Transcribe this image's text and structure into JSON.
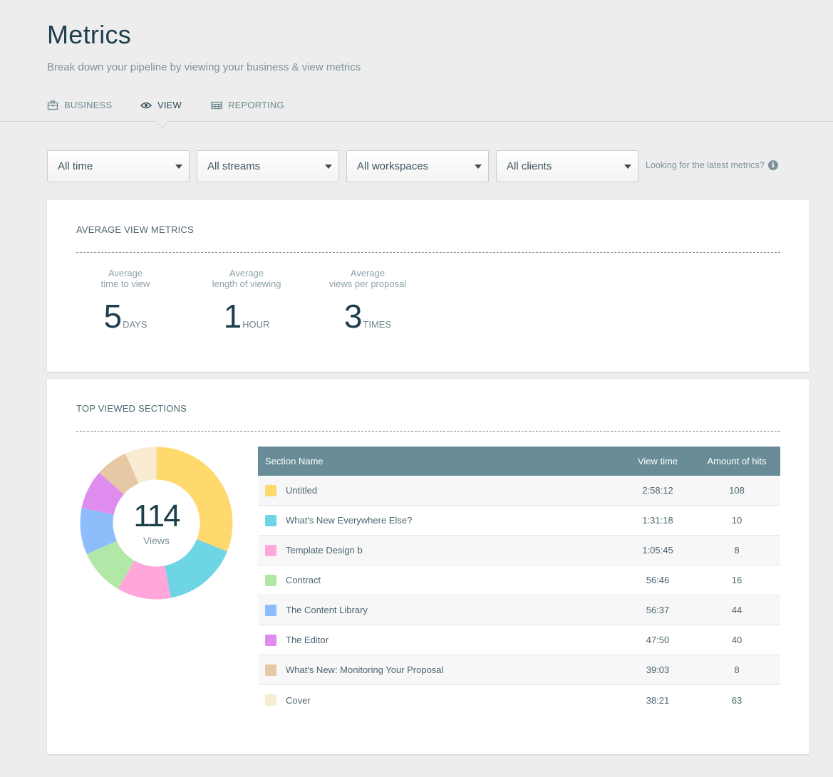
{
  "header": {
    "title": "Metrics",
    "subtitle": "Break down your pipeline by viewing your business & view metrics"
  },
  "tabs": [
    {
      "label": "BUSINESS",
      "icon": "briefcase-icon",
      "active": false
    },
    {
      "label": "VIEW",
      "icon": "eye-icon",
      "active": true
    },
    {
      "label": "REPORTING",
      "icon": "table-icon",
      "active": false
    }
  ],
  "filters": {
    "time": "All time",
    "streams": "All streams",
    "workspaces": "All workspaces",
    "clients": "All clients",
    "hint": "Looking for the latest metrics?"
  },
  "average_metrics": {
    "title": "AVERAGE VIEW METRICS",
    "items": [
      {
        "label_line1": "Average",
        "label_line2": "time to view",
        "value": "5",
        "unit": "DAYS"
      },
      {
        "label_line1": "Average",
        "label_line2": "length of viewing",
        "value": "1",
        "unit": "HOUR"
      },
      {
        "label_line1": "Average",
        "label_line2": "views per proposal",
        "value": "3",
        "unit": "TIMES"
      }
    ]
  },
  "top_sections": {
    "title": "TOP VIEWED SECTIONS",
    "total": "114",
    "total_label": "Views",
    "columns": {
      "name": "Section Name",
      "time": "View time",
      "hits": "Amount of hits"
    },
    "rows": [
      {
        "name": "Untitled",
        "time": "2:58:12",
        "hits": "108",
        "color": "#ffd86e"
      },
      {
        "name": "What's New Everywhere Else?",
        "time": "1:31:18",
        "hits": "10",
        "color": "#6dd5e3"
      },
      {
        "name": "Template Design b",
        "time": "1:05:45",
        "hits": "8",
        "color": "#ffa6da"
      },
      {
        "name": "Contract",
        "time": "56:46",
        "hits": "16",
        "color": "#b2e8a7"
      },
      {
        "name": "The Content Library",
        "time": "56:37",
        "hits": "44",
        "color": "#8dbdfb"
      },
      {
        "name": "The Editor",
        "time": "47:50",
        "hits": "40",
        "color": "#df8cef"
      },
      {
        "name": "What's New: Monitoring Your Proposal",
        "time": "39:03",
        "hits": "8",
        "color": "#e6c8a4"
      },
      {
        "name": "Cover",
        "time": "38:21",
        "hits": "63",
        "color": "#f8ecd3"
      }
    ]
  },
  "chart_data": {
    "type": "pie",
    "categories": [
      "Untitled",
      "What's New Everywhere Else?",
      "Template Design b",
      "Contract",
      "The Content Library",
      "The Editor",
      "What's New: Monitoring Your Proposal",
      "Cover"
    ],
    "values": [
      10692,
      5478,
      3945,
      3406,
      3397,
      2870,
      2343,
      2301
    ],
    "colors": [
      "#ffd86e",
      "#6dd5e3",
      "#ffa6da",
      "#b2e8a7",
      "#8dbdfb",
      "#df8cef",
      "#e6c8a4",
      "#f8ecd3"
    ]
  }
}
